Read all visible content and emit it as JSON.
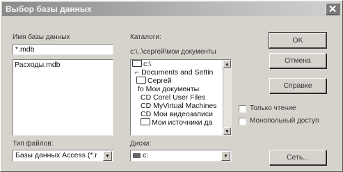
{
  "window": {
    "title": "Выбор базы данных",
    "close": "✕"
  },
  "db_name": {
    "label": "Имя базы данных",
    "value": "*.mdb",
    "files": [
      "Расходы.mdb"
    ]
  },
  "catalogs": {
    "label": "Каталоги:",
    "path": "c:\\..\\сергей\\мои документы",
    "items": [
      "c:\\",
      "Documents and Settin",
      "Сергей",
      "fo Мои документы",
      "CD Corel User Files",
      "CD MyVirtual Machines",
      "CD Мои видеозаписи",
      "Мои источники да"
    ]
  },
  "buttons": {
    "ok": "OK",
    "cancel": "Отмена",
    "help": "Справке",
    "network": "Сеть..."
  },
  "options": {
    "readonly": "Только чтение",
    "exclusive": "Монопольный доступ"
  },
  "file_type": {
    "label": "Тип файлов:",
    "value": "Базы данных Access (*.r"
  },
  "drives": {
    "label": "Диски:",
    "value": "c:"
  }
}
